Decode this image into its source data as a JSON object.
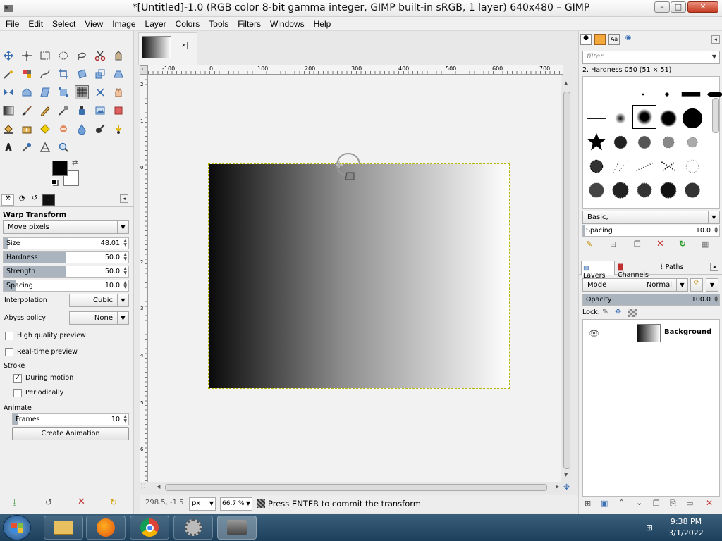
{
  "window": {
    "title": "*[Untitled]-1.0 (RGB color 8-bit gamma integer, GIMP built-in sRGB, 1 layer) 640x480 – GIMP",
    "minimize": "–",
    "maximize": "□",
    "close": "✕"
  },
  "menu": [
    "File",
    "Edit",
    "Select",
    "View",
    "Image",
    "Layer",
    "Colors",
    "Tools",
    "Filters",
    "Windows",
    "Help"
  ],
  "tool_options": {
    "title": "Warp Transform",
    "behavior": "Move pixels",
    "size": {
      "label": "Size",
      "value": "48.01",
      "fraction": 0.04
    },
    "hardness": {
      "label": "Hardness",
      "value": "50.0",
      "fraction": 0.5
    },
    "strength": {
      "label": "Strength",
      "value": "50.0",
      "fraction": 0.5
    },
    "spacing": {
      "label": "Spacing",
      "value": "10.0",
      "fraction": 0.1
    },
    "interpolation": {
      "label": "Interpolation",
      "value": "Cubic"
    },
    "abyss": {
      "label": "Abyss policy",
      "value": "None"
    },
    "high_quality": {
      "label": "High quality preview",
      "checked": false
    },
    "realtime": {
      "label": "Real-time preview",
      "checked": false
    },
    "stroke_label": "Stroke",
    "during_motion": {
      "label": "During motion",
      "checked": true,
      "mark": "✓"
    },
    "periodically": {
      "label": "Periodically",
      "checked": false
    },
    "animate_label": "Animate",
    "frames": {
      "label": "Frames",
      "value": "10",
      "fraction": 0.05
    },
    "create_animation": "Create Animation"
  },
  "rulers": {
    "h_ticks": [
      "-100",
      "0",
      "100",
      "200",
      "300",
      "400",
      "500",
      "600",
      "700"
    ],
    "v_ticks": [
      "2",
      "1",
      "0",
      "1",
      "2",
      "3",
      "4",
      "5",
      "6"
    ]
  },
  "status": {
    "coords": "298.5, -1.5",
    "unit": "px",
    "zoom": "66.7 %",
    "message": "Press ENTER to commit the transform"
  },
  "brushes": {
    "filter_placeholder": "filter",
    "current": "2. Hardness 050 (51 × 51)",
    "preset": "Basic,",
    "spacing": {
      "label": "Spacing",
      "value": "10.0"
    }
  },
  "layers_panel": {
    "tabs": [
      "Layers",
      "Channels",
      "Paths"
    ],
    "mode_label": "Mode",
    "mode_value": "Normal",
    "opacity": {
      "label": "Opacity",
      "value": "100.0"
    },
    "lock_label": "Lock:",
    "layers": [
      {
        "name": "Background"
      }
    ]
  },
  "taskbar": {
    "time": "9:38 PM",
    "date": "3/1/2022"
  },
  "colors": {
    "foreground": "#000000",
    "background": "#ffffff",
    "accent": "#a9b4bf"
  }
}
